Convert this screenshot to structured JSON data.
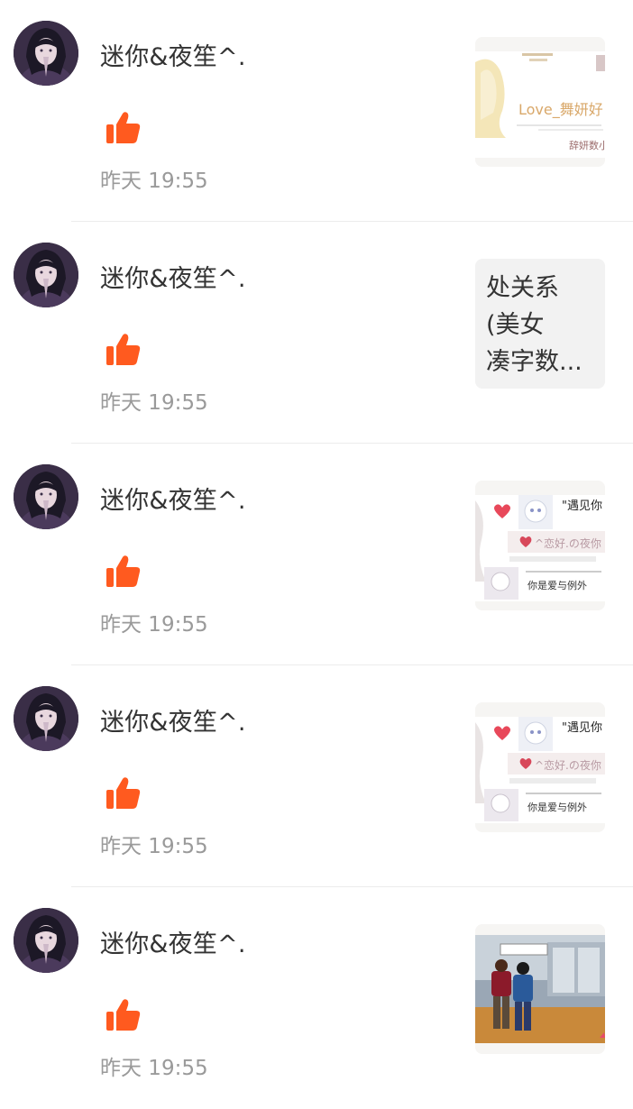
{
  "notifications": [
    {
      "user": "迷你&夜笙^.",
      "time": "昨天 19:55",
      "thumb_type": "image",
      "thumb_icon": "image-post-love-banner",
      "thumb_texts": [
        "Love_舞妍好",
        "辞妍数小"
      ]
    },
    {
      "user": "迷你&夜笙^.",
      "time": "昨天 19:55",
      "thumb_type": "text",
      "thumb_lines": [
        "处关系",
        "(美女",
        "凑字数..."
      ]
    },
    {
      "user": "迷你&夜笙^.",
      "time": "昨天 19:55",
      "thumb_type": "image",
      "thumb_icon": "image-post-anime-card",
      "thumb_texts": [
        "\"遇见你",
        "^恋好.の夜你",
        "你是爱与例外"
      ]
    },
    {
      "user": "迷你&夜笙^.",
      "time": "昨天 19:55",
      "thumb_type": "image",
      "thumb_icon": "image-post-anime-card",
      "thumb_texts": [
        "\"遇见你",
        "^恋好.の夜你",
        "你是爱与例外"
      ]
    },
    {
      "user": "迷你&夜笙^.",
      "time": "昨天 19:55",
      "thumb_type": "image",
      "thumb_icon": "image-post-game-scene",
      "thumb_texts": []
    }
  ],
  "colors": {
    "like": "#ff5a1f",
    "username": "#333333",
    "time": "#9a9a9a",
    "divider": "#ececec"
  },
  "icons": {
    "like": "thumbs-up-icon",
    "avatar": "avatar-image"
  }
}
